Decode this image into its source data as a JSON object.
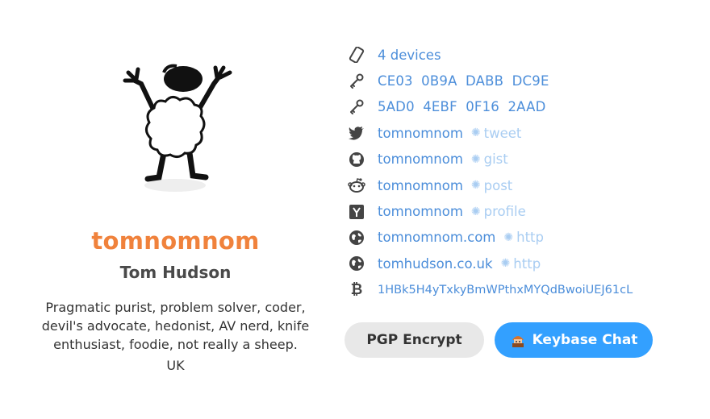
{
  "profile": {
    "username": "tomnomnom",
    "full_name": "Tom Hudson",
    "bio": "Pragmatic purist, problem solver, coder, devil's advocate, hedonist, AV nerd, knife enthusiast, foodie, not really a sheep.",
    "location": "UK",
    "avatar_icon": "sheep-avatar"
  },
  "proofs": [
    {
      "icon": "device-icon",
      "value": "4 devices"
    },
    {
      "icon": "key-icon",
      "value": "CE03 0B9A DABB DC9E"
    },
    {
      "icon": "key-icon",
      "value": "5AD0 4EBF 0F16 2AAD"
    },
    {
      "icon": "twitter-icon",
      "value": "tomnomnom",
      "badge": "tweet"
    },
    {
      "icon": "github-icon",
      "value": "tomnomnom",
      "badge": "gist"
    },
    {
      "icon": "reddit-icon",
      "value": "tomnomnom",
      "badge": "post"
    },
    {
      "icon": "hackernews-icon",
      "value": "tomnomnom",
      "badge": "profile"
    },
    {
      "icon": "globe-icon",
      "value": "tomnomnom.com",
      "badge": "http"
    },
    {
      "icon": "globe-icon",
      "value": "tomhudson.co.uk",
      "badge": "http"
    },
    {
      "icon": "bitcoin-icon",
      "value": "1HBk5H4yTxkyBmWPthxMYQdBwoiUEJ61cL"
    }
  ],
  "actions": {
    "pgp_label": "PGP Encrypt",
    "chat_label": "Keybase Chat"
  },
  "colors": {
    "username": "#f0823c",
    "link": "#4c8eda",
    "badge": "#a9cdf2",
    "chat_button": "#33a0ff",
    "pgp_button": "#e8e8e8"
  }
}
